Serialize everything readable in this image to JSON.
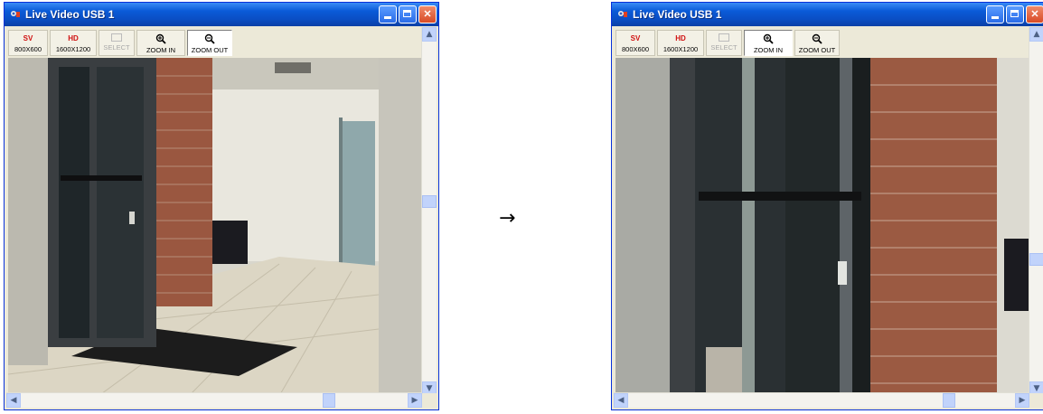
{
  "windows": [
    {
      "title": "Live Video USB 1",
      "controls": {
        "minimize": "minimize",
        "maximize": "maximize",
        "close": "✕"
      },
      "toolbar": [
        {
          "top": "SV",
          "bottom": "800X600"
        },
        {
          "top": "HD",
          "bottom": "1600X1200"
        },
        {
          "top": "",
          "bottom": "SELECT",
          "state": "disabled"
        },
        {
          "top": "zoom-in-icon",
          "bottom": "ZOOM IN"
        },
        {
          "top": "zoom-out-icon",
          "bottom": "ZOOM OUT",
          "state": "pressed"
        }
      ],
      "view": "full"
    },
    {
      "title": "Live Video USB 1",
      "controls": {
        "minimize": "minimize",
        "maximize": "maximize",
        "close": "✕"
      },
      "toolbar": [
        {
          "top": "SV",
          "bottom": "800X600"
        },
        {
          "top": "HD",
          "bottom": "1600X1200"
        },
        {
          "top": "",
          "bottom": "SELECT",
          "state": "disabled"
        },
        {
          "top": "zoom-in-icon",
          "bottom": "ZOOM IN",
          "state": "pressed"
        },
        {
          "top": "zoom-out-icon",
          "bottom": "ZOOM OUT"
        }
      ],
      "view": "zoomed"
    }
  ],
  "arrow": "→",
  "colors": {
    "titlebar": "#0a5bd8",
    "close_button": "#d84a26",
    "accent_red": "#d01010",
    "scrollbar": "#c1d3fb"
  }
}
